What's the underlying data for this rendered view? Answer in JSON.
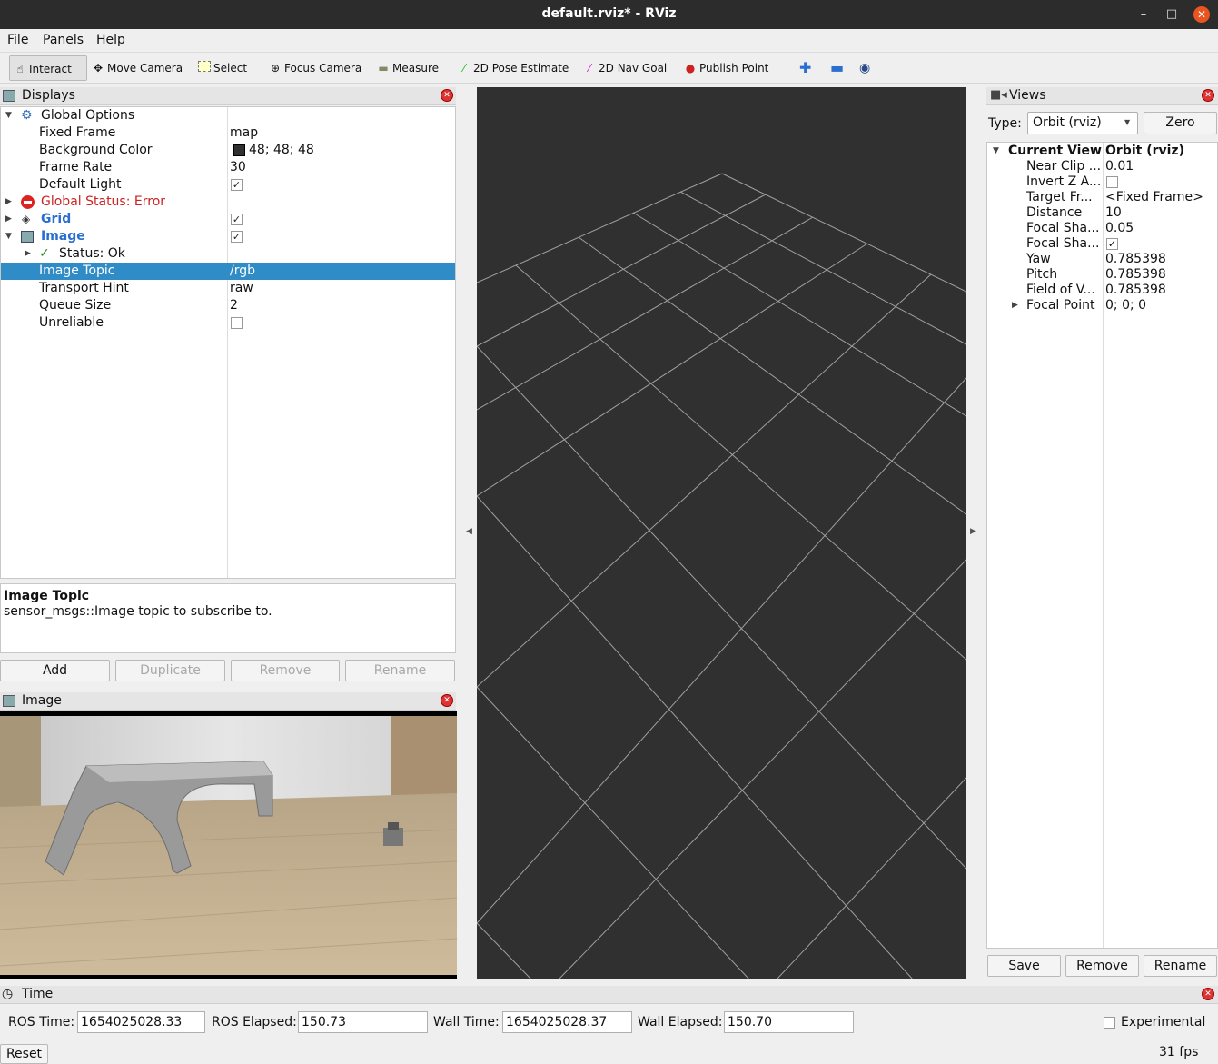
{
  "window": {
    "title": "default.rviz* - RViz",
    "minimize": "–",
    "maximize": "□",
    "close": "✕"
  },
  "menu": [
    "File",
    "Panels",
    "Help"
  ],
  "toolbar": {
    "interact": "Interact",
    "move_camera": "Move Camera",
    "select": "Select",
    "focus_camera": "Focus Camera",
    "measure": "Measure",
    "pose_estimate": "2D Pose Estimate",
    "nav_goal": "2D Nav Goal",
    "publish_point": "Publish Point"
  },
  "displays": {
    "title": "Displays",
    "global_options": "Global Options",
    "fixed_frame_label": "Fixed Frame",
    "fixed_frame": "map",
    "bg_color_label": "Background Color",
    "bg_color": "48; 48; 48",
    "bg_color_hex": "#303030",
    "frame_rate_label": "Frame Rate",
    "frame_rate": "30",
    "default_light_label": "Default Light",
    "default_light": true,
    "global_status": "Global Status: Error",
    "grid": "Grid",
    "grid_enabled": true,
    "image": "Image",
    "image_enabled": true,
    "status_ok": "Status: Ok",
    "image_topic_label": "Image Topic",
    "image_topic": "/rgb",
    "transport_hint_label": "Transport Hint",
    "transport_hint": "raw",
    "queue_size_label": "Queue Size",
    "queue_size": "2",
    "unreliable_label": "Unreliable",
    "unreliable": false
  },
  "description": {
    "title": "Image Topic",
    "text": "sensor_msgs::Image topic to subscribe to."
  },
  "buttons": {
    "add": "Add",
    "duplicate": "Duplicate",
    "remove": "Remove",
    "rename": "Rename"
  },
  "image_panel": {
    "title": "Image"
  },
  "views": {
    "title": "Views",
    "type_label": "Type:",
    "type_value": "Orbit (rviz)",
    "zero": "Zero",
    "current_view": "Current View",
    "current_view_value": "Orbit (rviz)",
    "props": [
      {
        "k": "Near Clip ...",
        "v": "0.01"
      },
      {
        "k": "Invert Z A...",
        "v": ""
      },
      {
        "k": "Target Fr...",
        "v": "<Fixed Frame>"
      },
      {
        "k": "Distance",
        "v": "10"
      },
      {
        "k": "Focal Sha...",
        "v": "0.05"
      },
      {
        "k": "Focal Sha...",
        "v": ""
      },
      {
        "k": "Yaw",
        "v": "0.785398"
      },
      {
        "k": "Pitch",
        "v": "0.785398"
      },
      {
        "k": "Field of V...",
        "v": "0.785398"
      },
      {
        "k": "Focal Point",
        "v": "0; 0; 0"
      }
    ],
    "save": "Save",
    "remove": "Remove",
    "rename": "Rename"
  },
  "time": {
    "title": "Time",
    "ros_time_label": "ROS Time:",
    "ros_time": "1654025028.33",
    "ros_elapsed_label": "ROS Elapsed:",
    "ros_elapsed": "150.73",
    "wall_time_label": "Wall Time:",
    "wall_time": "1654025028.37",
    "wall_elapsed_label": "Wall Elapsed:",
    "wall_elapsed": "150.70",
    "experimental": "Experimental",
    "reset": "Reset",
    "fps": "31 fps"
  },
  "colors": {
    "accent": "#308cc6",
    "error": "#cc2222",
    "status_ok": "#1e8c1e",
    "viewport": "#303030"
  }
}
